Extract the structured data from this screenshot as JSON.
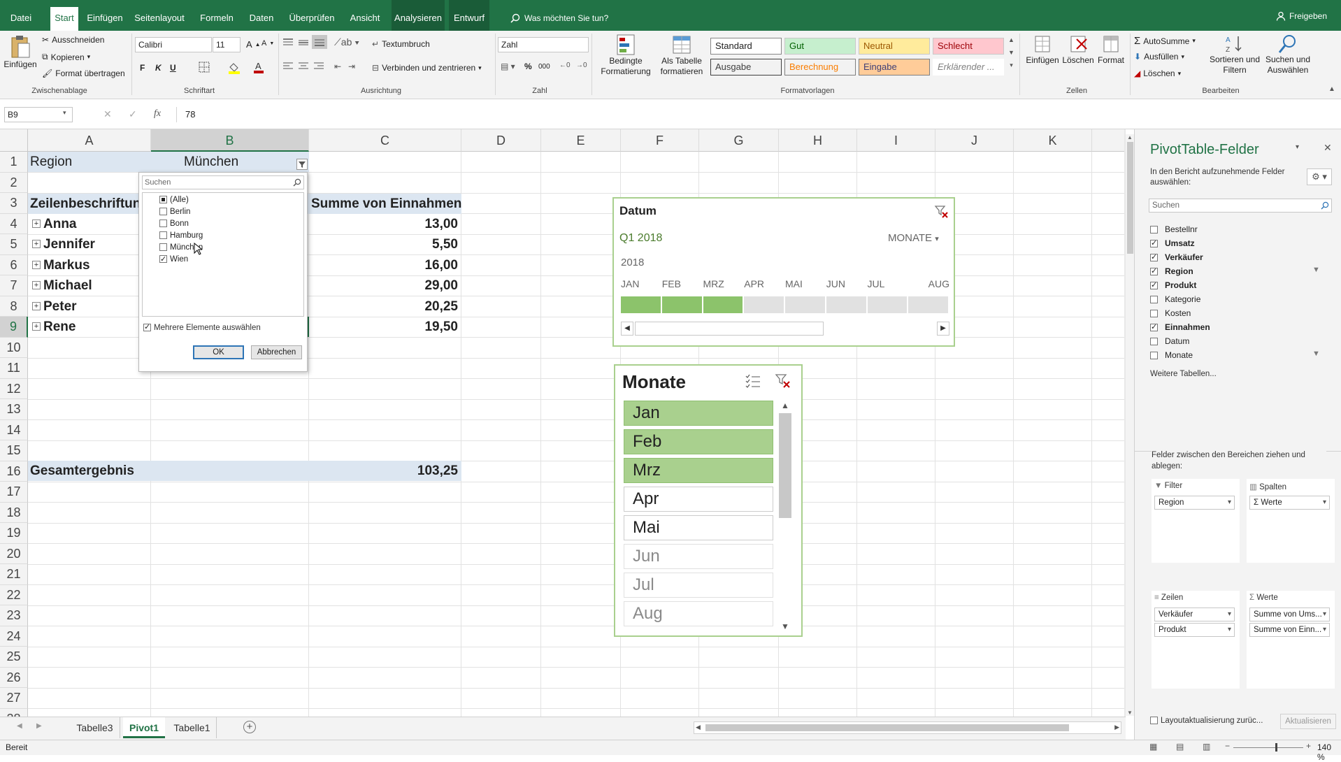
{
  "menu": {
    "tabs": [
      "Datei",
      "Start",
      "Einfügen",
      "Seitenlayout",
      "Formeln",
      "Daten",
      "Überprüfen",
      "Ansicht",
      "Analysieren",
      "Entwurf"
    ],
    "search": "Was möchten Sie tun?",
    "share": "Freigeben"
  },
  "ribbon": {
    "clipboard": {
      "paste": "Einfügen",
      "cut": "Ausschneiden",
      "copy": "Kopieren",
      "format_painter": "Format übertragen",
      "label": "Zwischenablage"
    },
    "font": {
      "name": "Calibri",
      "size": "11",
      "bold": "F",
      "italic": "K",
      "underline": "U",
      "label": "Schriftart"
    },
    "alignment": {
      "wrap": "Textumbruch",
      "merge": "Verbinden und zentrieren",
      "label": "Ausrichtung"
    },
    "number": {
      "format": "Zahl",
      "percent": "%",
      "thousands": "000",
      "label": "Zahl"
    },
    "styles": {
      "cond": "Bedingte Formatierung",
      "as_table": "Als Tabelle formatieren",
      "standard": "Standard",
      "gut": "Gut",
      "neutral": "Neutral",
      "schlecht": "Schlecht",
      "ausgabe": "Ausgabe",
      "berechnung": "Berechnung",
      "eingabe": "Eingabe",
      "erklaerend": "Erklärender ...",
      "label": "Formatvorlagen"
    },
    "cells": {
      "insert": "Einfügen",
      "delete": "Löschen",
      "format": "Format",
      "label": "Zellen"
    },
    "editing": {
      "autosum": "AutoSumme",
      "fill": "Ausfüllen",
      "clear": "Löschen",
      "sort": "Sortieren und Filtern",
      "find": "Suchen und Auswählen",
      "label": "Bearbeiten"
    }
  },
  "formula_bar": {
    "namebox": "B9",
    "fx": "fx",
    "value": "78"
  },
  "grid": {
    "columns": [
      "A",
      "B",
      "C",
      "D",
      "E",
      "F",
      "G",
      "H",
      "I",
      "J",
      "K"
    ],
    "rows": [
      "1",
      "2",
      "3",
      "4",
      "5",
      "6",
      "7",
      "8",
      "9",
      "10",
      "11",
      "12",
      "13",
      "14",
      "15",
      "16",
      "17",
      "18",
      "19",
      "20",
      "21",
      "22",
      "23",
      "24",
      "25",
      "26",
      "27",
      "28"
    ],
    "a1": "Region",
    "b1": "München",
    "a3": "Zeilenbeschriftung",
    "c3": "Summe von Einnahmen",
    "entries": [
      {
        "name": "Anna",
        "value": "13,00"
      },
      {
        "name": "Jennifer",
        "value": "5,50"
      },
      {
        "name": "Markus",
        "value": "16,00"
      },
      {
        "name": "Michael",
        "value": "29,00"
      },
      {
        "name": "Peter",
        "value": "20,25"
      },
      {
        "name": "Rene",
        "value": "19,50"
      }
    ],
    "total_label": "Gesamtergebnis",
    "total_value": "103,25"
  },
  "filter_popup": {
    "search_placeholder": "Suchen",
    "items": [
      {
        "label": "(Alle)",
        "state": "partial"
      },
      {
        "label": "Berlin",
        "state": "off"
      },
      {
        "label": "Bonn",
        "state": "off"
      },
      {
        "label": "Hamburg",
        "state": "off"
      },
      {
        "label": "München",
        "state": "off"
      },
      {
        "label": "Wien",
        "state": "on"
      }
    ],
    "multi_select": "Mehrere Elemente auswählen",
    "ok": "OK",
    "cancel": "Abbrechen"
  },
  "timeline": {
    "title": "Datum",
    "period": "Q1 2018",
    "level": "MONATE",
    "year": "2018",
    "months": [
      "JAN",
      "FEB",
      "MRZ",
      "APR",
      "MAI",
      "JUN",
      "JUL",
      "AUG"
    ],
    "selected_months": 3
  },
  "slicer": {
    "title": "Monate",
    "items": [
      {
        "label": "Jan",
        "state": "sel"
      },
      {
        "label": "Feb",
        "state": "sel"
      },
      {
        "label": "Mrz",
        "state": "sel"
      },
      {
        "label": "Apr",
        "state": "unsel"
      },
      {
        "label": "Mai",
        "state": "unsel"
      },
      {
        "label": "Jun",
        "state": "dim"
      },
      {
        "label": "Jul",
        "state": "dim"
      },
      {
        "label": "Aug",
        "state": "dim"
      }
    ]
  },
  "sheet_tabs": [
    "Tabelle3",
    "Pivot1",
    "Tabelle1"
  ],
  "active_tab": "Pivot1",
  "status": {
    "ready": "Bereit",
    "zoom": "140 %"
  },
  "pivot_panel": {
    "title": "PivotTable-Felder",
    "subtitle": "In den Bericht aufzunehmende Felder auswählen:",
    "search_placeholder": "Suchen",
    "fields": [
      {
        "label": "Bestellnr",
        "checked": false,
        "bold": false,
        "filter": false
      },
      {
        "label": "Umsatz",
        "checked": true,
        "bold": true,
        "filter": false
      },
      {
        "label": "Verkäufer",
        "checked": true,
        "bold": true,
        "filter": false
      },
      {
        "label": "Region",
        "checked": true,
        "bold": true,
        "filter": true
      },
      {
        "label": "Produkt",
        "checked": true,
        "bold": true,
        "filter": false
      },
      {
        "label": "Kategorie",
        "checked": false,
        "bold": false,
        "filter": false
      },
      {
        "label": "Kosten",
        "checked": false,
        "bold": false,
        "filter": false
      },
      {
        "label": "Einnahmen",
        "checked": true,
        "bold": true,
        "filter": false
      },
      {
        "label": "Datum",
        "checked": false,
        "bold": false,
        "filter": false
      },
      {
        "label": "Monate",
        "checked": false,
        "bold": false,
        "filter": true
      }
    ],
    "more_tables": "Weitere Tabellen...",
    "drag_hint": "Felder zwischen den Bereichen ziehen und ablegen:",
    "filter_label": "Filter",
    "columns_label": "Spalten",
    "rows_label": "Zeilen",
    "values_label": "Werte",
    "filter_items": [
      "Region"
    ],
    "column_items": [
      "Werte"
    ],
    "row_items": [
      "Verkäufer",
      "Produkt"
    ],
    "value_items": [
      "Summe von Ums...",
      "Summe von Einn..."
    ],
    "defer": "Layoutaktualisierung zurüc...",
    "update": "Aktualisieren"
  },
  "colors": {
    "excel_green": "#217346",
    "slicer_green": "#a9d08e",
    "pivot_header": "#dce6f1"
  }
}
